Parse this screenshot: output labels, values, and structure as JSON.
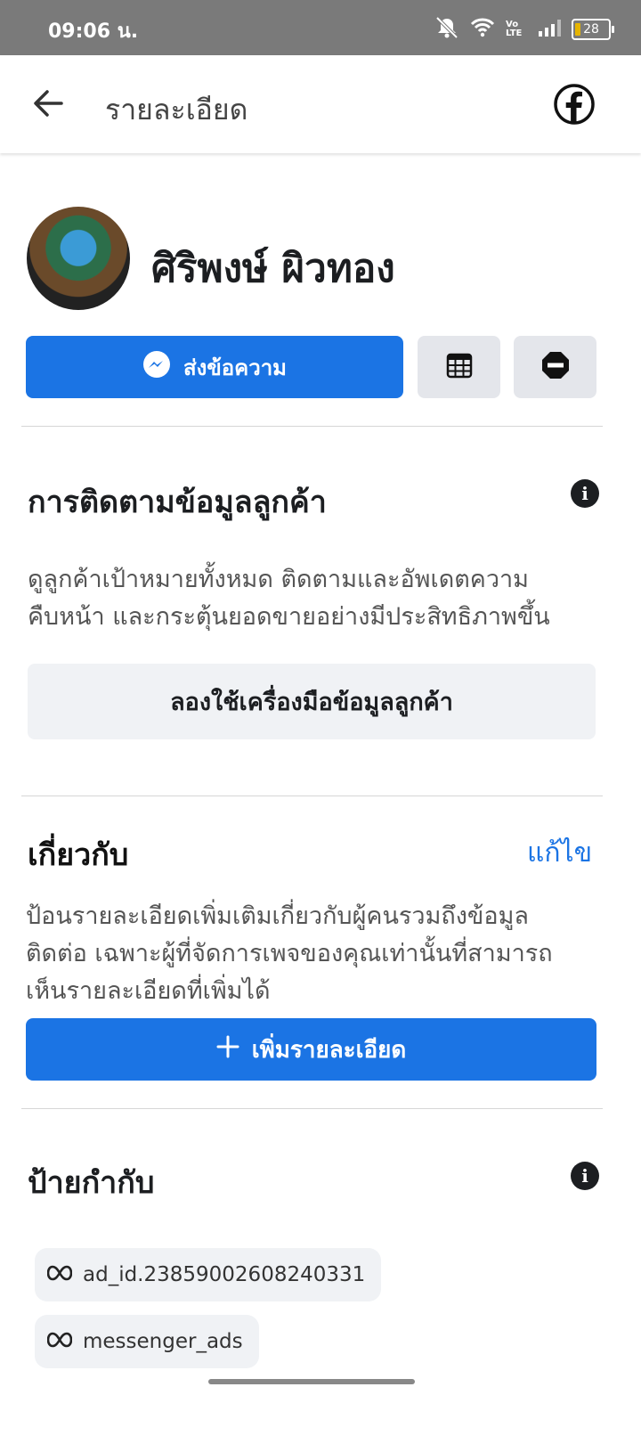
{
  "status_bar": {
    "time": "09:06 น.",
    "battery": "28",
    "lte_label": "Vo LTE"
  },
  "header": {
    "title": "รายละเอียด"
  },
  "profile": {
    "name": "ศิริพงษ์ ผิวทอง"
  },
  "actions": {
    "message_label": "ส่งข้อความ"
  },
  "customer_tracking": {
    "heading": "การติดตามข้อมูลลูกค้า",
    "line1": "ดูลูกค้าเป้าหมายทั้งหมด ติดตามและอัพเดตความ",
    "line2": "คืบหน้า และกระตุ้นยอดขายอย่างมีประสิทธิภาพขึ้น",
    "button_label": "ลองใช้เครื่องมือข้อมูลลูกค้า"
  },
  "about": {
    "heading": "เกี่ยวกับ",
    "edit_label": "แก้ไข",
    "line1": "ป้อนรายละเอียดเพิ่มเติมเกี่ยวกับผู้คนรวมถึงข้อมูล",
    "line2": "ติดต่อ เฉพาะผู้ที่จัดการเพจของคุณเท่านั้นที่สามารถ",
    "line3": "เห็นรายละเอียดที่เพิ่มได้",
    "add_label": "เพิ่มรายละเอียด"
  },
  "labels": {
    "heading": "ป้ายกำกับ",
    "tags": [
      "ad_id.23859002608240331",
      "messenger_ads"
    ]
  }
}
